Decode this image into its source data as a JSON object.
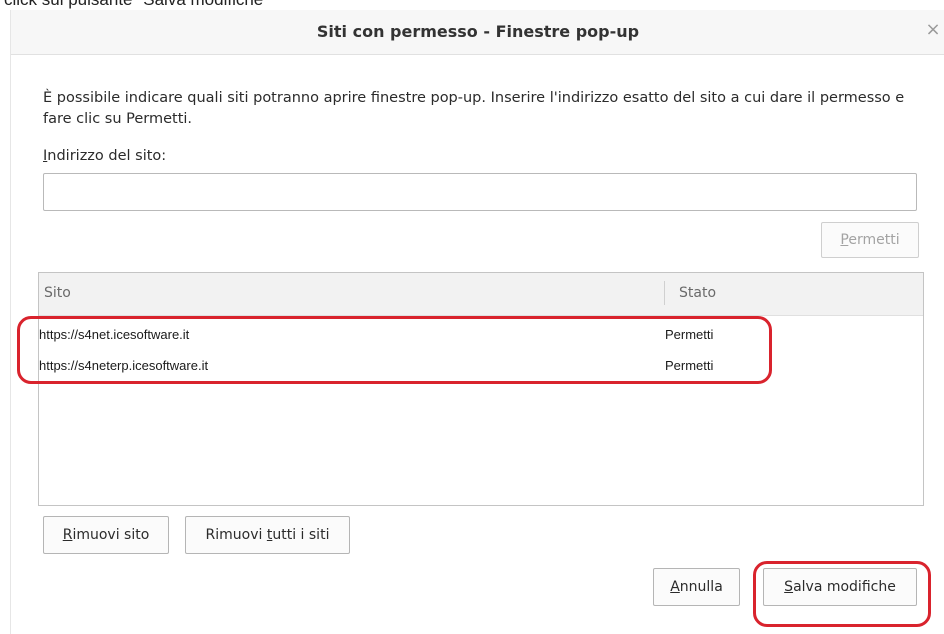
{
  "caption": "click sul pulsante \"Salva modifiche\"",
  "dialog": {
    "title": "Siti con permesso - Finestre pop-up",
    "close_symbol": "×",
    "description": "È possibile indicare quali siti potranno aprire finestre pop-up. Inserire l'indirizzo esatto del sito a cui dare il permesso e fare clic su Permetti.",
    "address_label_first": "I",
    "address_label_rest": "ndirizzo del sito:",
    "address_value": "",
    "permit_button": {
      "u": "P",
      "rest": "ermetti",
      "disabled": true
    }
  },
  "table": {
    "headers": {
      "site": "Sito",
      "state": "Stato"
    },
    "rows": [
      {
        "site": "https://s4net.icesoftware.it",
        "state": "Permetti"
      },
      {
        "site": "https://s4neterp.icesoftware.it",
        "state": "Permetti"
      }
    ]
  },
  "buttons": {
    "remove_site": {
      "u": "R",
      "rest": "imuovi sito"
    },
    "remove_all": {
      "pre": "Rimuovi ",
      "u": "t",
      "rest": "utti i siti"
    },
    "cancel": {
      "u": "A",
      "rest": "nnulla"
    },
    "save": {
      "u": "S",
      "rest": "alva modifiche"
    }
  },
  "colors": {
    "annotation": "#d9232d",
    "titlebar": "#f7f7f7",
    "header": "#f2f2f2"
  }
}
